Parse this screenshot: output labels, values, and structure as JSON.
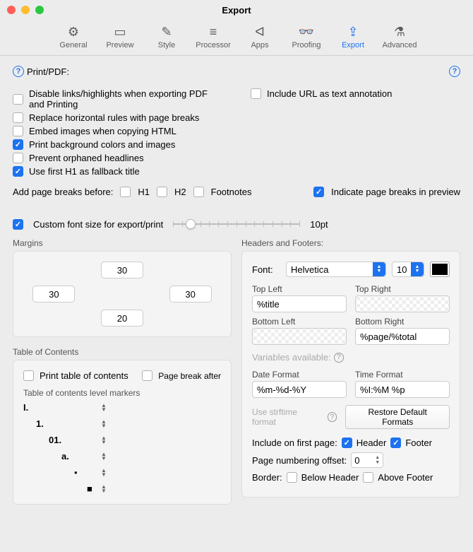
{
  "window": {
    "title": "Export"
  },
  "toolbar": {
    "items": [
      {
        "label": "General",
        "active": false
      },
      {
        "label": "Preview",
        "active": false
      },
      {
        "label": "Style",
        "active": false
      },
      {
        "label": "Processor",
        "active": false
      },
      {
        "label": "Apps",
        "active": false
      },
      {
        "label": "Proofing",
        "active": false
      },
      {
        "label": "Export",
        "active": true
      },
      {
        "label": "Advanced",
        "active": false
      }
    ]
  },
  "print_pdf": {
    "heading": "Print/PDF:",
    "disable_links": {
      "label": "Disable links/highlights when exporting PDF and Printing",
      "checked": false
    },
    "include_url": {
      "label": "Include URL as text annotation",
      "checked": false
    },
    "replace_hr": {
      "label": "Replace horizontal rules with page breaks",
      "checked": false
    },
    "embed_images": {
      "label": "Embed images when copying HTML",
      "checked": false
    },
    "print_bg": {
      "label": "Print background colors and images",
      "checked": true
    },
    "prevent_orphan": {
      "label": "Prevent orphaned headlines",
      "checked": false
    },
    "use_h1": {
      "label": "Use first H1 as fallback title",
      "checked": true
    },
    "pagebreak_label": "Add page breaks before:",
    "pb_h1": {
      "label": "H1",
      "checked": false
    },
    "pb_h2": {
      "label": "H2",
      "checked": false
    },
    "pb_footnotes": {
      "label": "Footnotes",
      "checked": false
    },
    "indicate_pb": {
      "label": "Indicate page breaks in preview",
      "checked": true
    }
  },
  "custom_font": {
    "label": "Custom font size for export/print",
    "checked": true,
    "value": "10pt"
  },
  "margins": {
    "heading": "Margins",
    "top": "30",
    "left": "30",
    "right": "30",
    "bottom": "20"
  },
  "toc": {
    "heading": "Table of Contents",
    "print_toc": {
      "label": "Print table of contents",
      "checked": false
    },
    "page_break_after": {
      "label": "Page break after",
      "checked": false
    },
    "markers_label": "Table of contents level markers",
    "markers": [
      "I.",
      "1.",
      "01.",
      "a.",
      "•",
      "■"
    ]
  },
  "hf": {
    "heading": "Headers and Footers:",
    "font_label": "Font:",
    "font_name": "Helvetica",
    "font_size": "10",
    "top_left_label": "Top Left",
    "top_left": "%title",
    "top_right_label": "Top Right",
    "top_right": "",
    "bottom_left_label": "Bottom Left",
    "bottom_left": "",
    "bottom_right_label": "Bottom Right",
    "bottom_right": "%page/%total",
    "vars_label": "Variables available:",
    "date_format_label": "Date Format",
    "date_format": "%m-%d-%Y",
    "time_format_label": "Time Format",
    "time_format": "%I:%M %p",
    "strftime_label": "Use strftime format",
    "restore_btn": "Restore Default Formats",
    "include_first_label": "Include on first page:",
    "inc_header": {
      "label": "Header",
      "checked": true
    },
    "inc_footer": {
      "label": "Footer",
      "checked": true
    },
    "offset_label": "Page numbering offset:",
    "offset_value": "0",
    "border_label": "Border:",
    "below_header": {
      "label": "Below Header",
      "checked": false
    },
    "above_footer": {
      "label": "Above Footer",
      "checked": false
    }
  }
}
